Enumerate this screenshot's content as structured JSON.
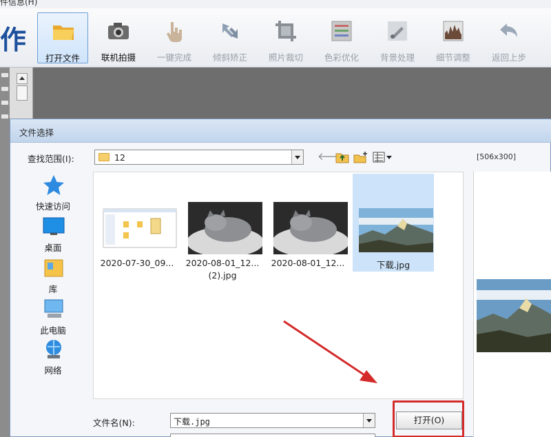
{
  "menu": {
    "partial_text": "件信息(H)"
  },
  "app": {
    "brand_text": "作"
  },
  "toolbar": [
    {
      "label": "打开文件",
      "icon": "folder-icon",
      "enabled": true,
      "selected": true
    },
    {
      "label": "联机拍摄",
      "icon": "camera-icon",
      "enabled": true,
      "selected": false
    },
    {
      "label": "一键完成",
      "icon": "hand-pointer-icon",
      "enabled": false,
      "selected": false
    },
    {
      "label": "倾斜矫正",
      "icon": "rotate-icon",
      "enabled": false,
      "selected": false
    },
    {
      "label": "照片裁切",
      "icon": "crop-icon",
      "enabled": false,
      "selected": false
    },
    {
      "label": "色彩优化",
      "icon": "color-sliders-icon",
      "enabled": false,
      "selected": false
    },
    {
      "label": "背景处理",
      "icon": "brush-icon",
      "enabled": false,
      "selected": false
    },
    {
      "label": "细节调整",
      "icon": "histogram-icon",
      "enabled": false,
      "selected": false
    },
    {
      "label": "返回上步",
      "icon": "undo-icon",
      "enabled": false,
      "selected": false
    }
  ],
  "dialog": {
    "title": "文件选择",
    "look_in_label": "查找范围(I):",
    "look_in_value": "12",
    "preview_size": "[506x300]",
    "places": [
      {
        "label": "快速访问",
        "icon": "star-icon"
      },
      {
        "label": "桌面",
        "icon": "desktop-icon"
      },
      {
        "label": "库",
        "icon": "library-icon"
      },
      {
        "label": "此电脑",
        "icon": "computer-icon"
      },
      {
        "label": "网络",
        "icon": "network-icon"
      }
    ],
    "files": [
      {
        "name": "2020-07-30_09...",
        "name2": "",
        "thumb": "screenshot-thumbnail",
        "selected": false
      },
      {
        "name": "2020-08-01_12...",
        "name2": "(2).jpg",
        "thumb": "cat-photo-thumbnail",
        "selected": false
      },
      {
        "name": "2020-08-01_12...",
        "name2": "",
        "thumb": "cat-photo-thumbnail",
        "selected": false
      },
      {
        "name": "下载.jpg",
        "name2": "",
        "thumb": "landscape-thumbnail",
        "selected": true
      }
    ],
    "filename_label": "文件名(N):",
    "filename_value": "下载.jpg",
    "open_button": "打开(O)"
  },
  "colors": {
    "accent": "#1c4f9c",
    "selection": "#cce3f9",
    "highlight_annotation": "#d42a2a"
  }
}
